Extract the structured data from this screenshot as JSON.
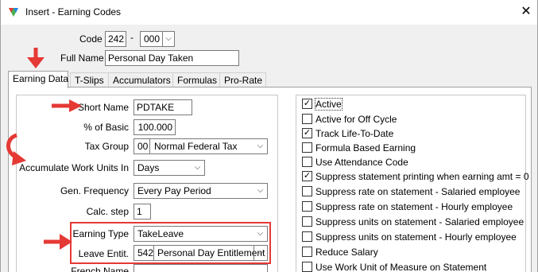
{
  "window": {
    "title": "Insert - Earning Codes",
    "close_glyph": "✕"
  },
  "header": {
    "code_label": "Code",
    "code_value": "242",
    "code_sep": "-",
    "code_suffix_value": "000",
    "fullname_label": "Full Name",
    "fullname_value": "Personal Day Taken"
  },
  "tabs": [
    {
      "label": "Earning Data"
    },
    {
      "label": "T-Slips"
    },
    {
      "label": "Accumulators"
    },
    {
      "label": "Formulas"
    },
    {
      "label": "Pro-Rate"
    }
  ],
  "form": {
    "short_name_label": "Short Name",
    "short_name_value": "PDTAKE",
    "pct_basic_label": "% of Basic",
    "pct_basic_value": "100.000",
    "tax_group_label": "Tax Group",
    "tax_group_code": "00",
    "tax_group_value": "Normal Federal Tax",
    "accum_units_label": "Accumulate Work Units In",
    "accum_units_value": "Days",
    "gen_freq_label": "Gen. Frequency",
    "gen_freq_value": "Every Pay Period",
    "calc_step_label": "Calc. step",
    "calc_step_value": "1",
    "earning_type_label": "Earning Type",
    "earning_type_value": "TakeLeave",
    "leave_entit_label": "Leave Entit.",
    "leave_entit_code": "542",
    "leave_entit_value": "Personal Day Entitlement",
    "french_name_label": "French Name"
  },
  "checkboxes": [
    {
      "label": "Active",
      "checked": true
    },
    {
      "label": "Active for Off Cycle",
      "checked": false
    },
    {
      "label": "Track Life-To-Date",
      "checked": true
    },
    {
      "label": "Formula Based Earning",
      "checked": false
    },
    {
      "label": "Use Attendance Code",
      "checked": false
    },
    {
      "label": "Suppress statement printing when earning amt = 0",
      "checked": true
    },
    {
      "label": "Suppress rate on statement - Salaried employee",
      "checked": false
    },
    {
      "label": "Suppress rate on statement - Hourly employee",
      "checked": false
    },
    {
      "label": "Suppress units on statement - Salaried employee",
      "checked": false
    },
    {
      "label": "Suppress units on statement - Hourly employee",
      "checked": false
    },
    {
      "label": "Reduce Salary",
      "checked": false
    },
    {
      "label": "Use Work Unit of Measure on Statement",
      "checked": false
    }
  ],
  "icons": {
    "dropdown": "chevron-down-icon",
    "check": "✓"
  },
  "colors": {
    "annotation_red": "#e53935"
  }
}
